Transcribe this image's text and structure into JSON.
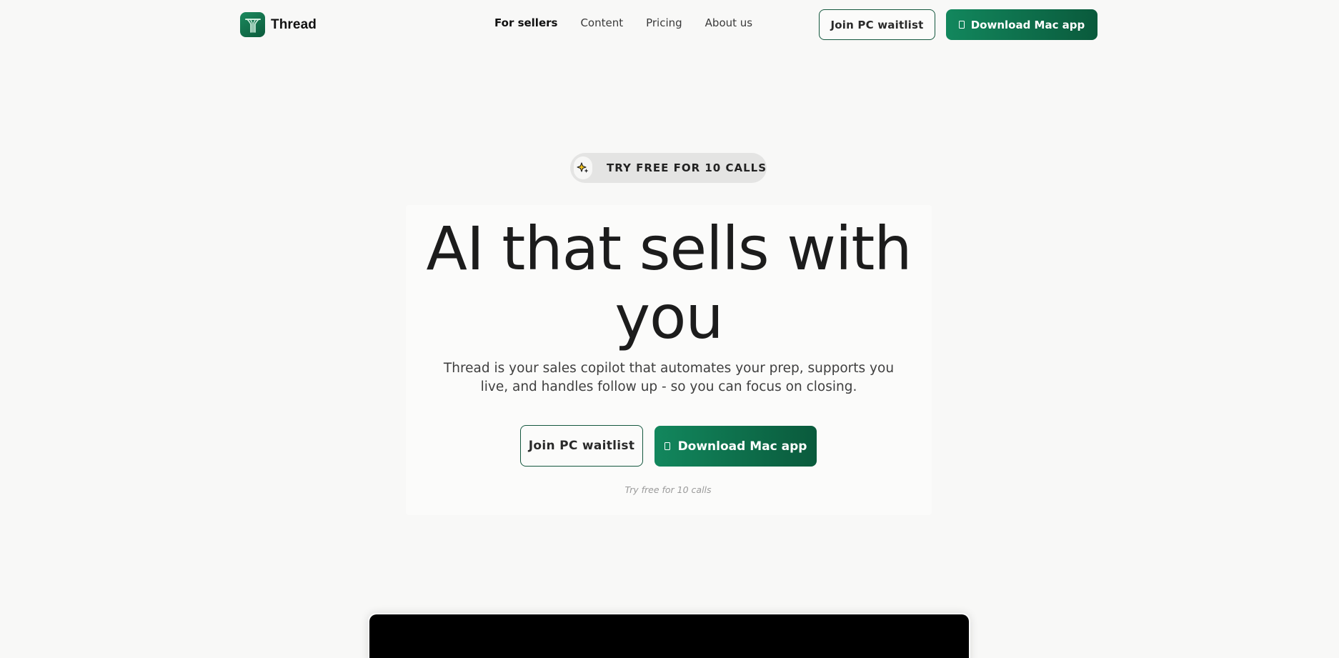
{
  "brand": {
    "name": "Thread",
    "colors": {
      "primary": "#12875d",
      "primary_dark": "#0a5a3c",
      "background": "#f8f8f7"
    }
  },
  "nav": {
    "items": [
      {
        "label": "For sellers",
        "active": true
      },
      {
        "label": "Content"
      },
      {
        "label": "Pricing"
      },
      {
        "label": "About us"
      }
    ]
  },
  "header": {
    "waitlist_label": "Join PC waitlist",
    "download_label": "Download Mac app",
    "download_icon": "apple-icon"
  },
  "hero": {
    "badge_icon": "sparkle-icon",
    "badge_text": "TRY FREE FOR 10 CALLS",
    "title": "AI that sells with you",
    "subtitle": "Thread is your sales copilot that automates your prep, supports you live, and handles follow up - so you can focus on closing.",
    "waitlist_label": "Join PC waitlist",
    "download_label": "Download Mac app",
    "note": "Try free for 10 calls"
  }
}
